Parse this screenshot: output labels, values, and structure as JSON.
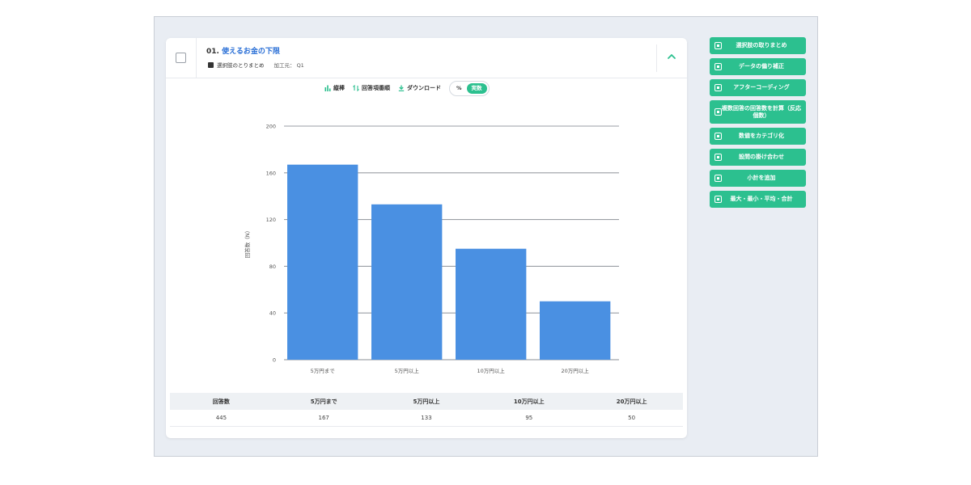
{
  "question": {
    "number": "01.",
    "title": "使えるお金の下限",
    "subtitle": "選択肢のとりまとめ",
    "meta": "加工元： Q1"
  },
  "toolbar": {
    "items": [
      "縦棒",
      "回答項番順",
      "ダウンロード"
    ],
    "toggle": [
      "%",
      "実数"
    ],
    "toggle_selected": "実数"
  },
  "chart_data": {
    "type": "bar",
    "categories": [
      "5万円まで",
      "5万円以上",
      "10万円以上",
      "20万円以上"
    ],
    "values": [
      167,
      133,
      95,
      50
    ],
    "ylabel": "回答数（N）",
    "ylim": [
      0,
      200
    ],
    "yticks": [
      0,
      40,
      80,
      120,
      160,
      200
    ],
    "grid": true,
    "bar_color": "#4a90e2"
  },
  "table": {
    "headers": [
      "回答数",
      "5万円まで",
      "5万円以上",
      "10万円以上",
      "20万円以上"
    ],
    "rows": [
      [
        "445",
        "167",
        "133",
        "95",
        "50"
      ]
    ]
  },
  "sidebar": {
    "buttons": [
      "選択肢の取りまとめ",
      "データの偏り補正",
      "アフターコーディング",
      "複数回答の回答数を計算（反応個数）",
      "数値をカテゴリ化",
      "設問の掛け合わせ",
      "小計を追加",
      "最大・最小・平均・合計"
    ]
  },
  "colors": {
    "accent": "#2cc08f",
    "bar": "#4a90e2",
    "title_link": "#2a6fd6"
  }
}
